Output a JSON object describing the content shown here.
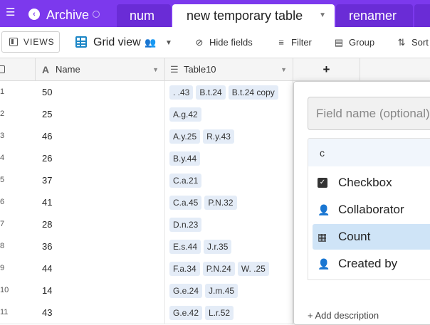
{
  "topbar": {
    "base_name": "Archive",
    "tabs": [
      {
        "label": "num"
      },
      {
        "label": "new temporary table",
        "active": true
      },
      {
        "label": "renamer"
      }
    ]
  },
  "toolbar": {
    "views_label": "VIEWS",
    "view_name": "Grid view",
    "hide_fields": "Hide fields",
    "filter": "Filter",
    "group": "Group",
    "sort": "Sort"
  },
  "header": {
    "col_name": "Name",
    "col_table": "Table10",
    "add_symbol": "+"
  },
  "rows": [
    {
      "num": "1",
      "name": "50",
      "links": [
        ". .43",
        "B.t.24",
        "B.t.24 copy"
      ]
    },
    {
      "num": "2",
      "name": "25",
      "links": [
        "A.g.42"
      ]
    },
    {
      "num": "3",
      "name": "46",
      "links": [
        "A.y.25",
        "R.y.43"
      ]
    },
    {
      "num": "4",
      "name": "26",
      "links": [
        "B.y.44"
      ]
    },
    {
      "num": "5",
      "name": "37",
      "links": [
        "C.a.21"
      ]
    },
    {
      "num": "6",
      "name": "41",
      "links": [
        "C.a.45",
        "P.N.32"
      ]
    },
    {
      "num": "7",
      "name": "28",
      "links": [
        "D.n.23"
      ]
    },
    {
      "num": "8",
      "name": "36",
      "links": [
        "E.s.44",
        "J.r.35"
      ]
    },
    {
      "num": "9",
      "name": "44",
      "links": [
        "F.a.34",
        "P.N.24",
        "W. .25"
      ]
    },
    {
      "num": "10",
      "name": "14",
      "links": [
        "G.e.24",
        "J.m.45"
      ]
    },
    {
      "num": "11",
      "name": "43",
      "links": [
        "G.e.42",
        "L.r.52"
      ]
    }
  ],
  "popup": {
    "field_name_placeholder": "Field name (optional)",
    "type_search_value": "c",
    "type_options": [
      {
        "label": "Checkbox",
        "icon": "checkbox-icon"
      },
      {
        "label": "Collaborator",
        "icon": "person-icon"
      },
      {
        "label": "Count",
        "icon": "count-icon",
        "selected": true
      },
      {
        "label": "Created by",
        "icon": "person-plus-icon"
      }
    ],
    "add_description": "+ Add description"
  },
  "colors": {
    "topbar": "#7c39ed",
    "grid_icon": "#1b86c6",
    "chip_bg": "#e4ecf7",
    "selected_option_bg": "#cfe4f7"
  }
}
